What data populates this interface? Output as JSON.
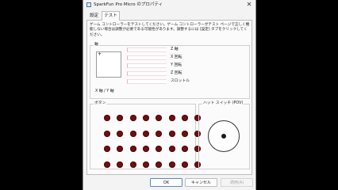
{
  "window": {
    "title": "SparkFun Pro Micro のプロパティ",
    "close_glyph": "✕"
  },
  "tabs": [
    {
      "label": "設定",
      "selected": false
    },
    {
      "label": "テスト",
      "selected": true
    }
  ],
  "description": "ゲーム コントローラーをテストしてください。ゲーム コントローラーがテスト ページで正しく機能しない場合は調整が必要である可能性があります。調整するには [設定] タブをクリックしてください。",
  "axes": {
    "group_label": "軸",
    "xy_label": "X 軸 / Y 軸",
    "crosshair": "+",
    "items": [
      "Z 軸",
      "X 回転",
      "Y 回転",
      "Z 回転",
      "スロットル"
    ]
  },
  "buttons": {
    "group_label": "ボタン",
    "rows": 4,
    "columns": 8,
    "active_color": "#6e0f12"
  },
  "hat": {
    "group_label": "ハット スイッチ (POV)"
  },
  "footer": {
    "ok_label": "OK",
    "cancel_label": "キャンセル",
    "apply_label": "適用(A)"
  }
}
